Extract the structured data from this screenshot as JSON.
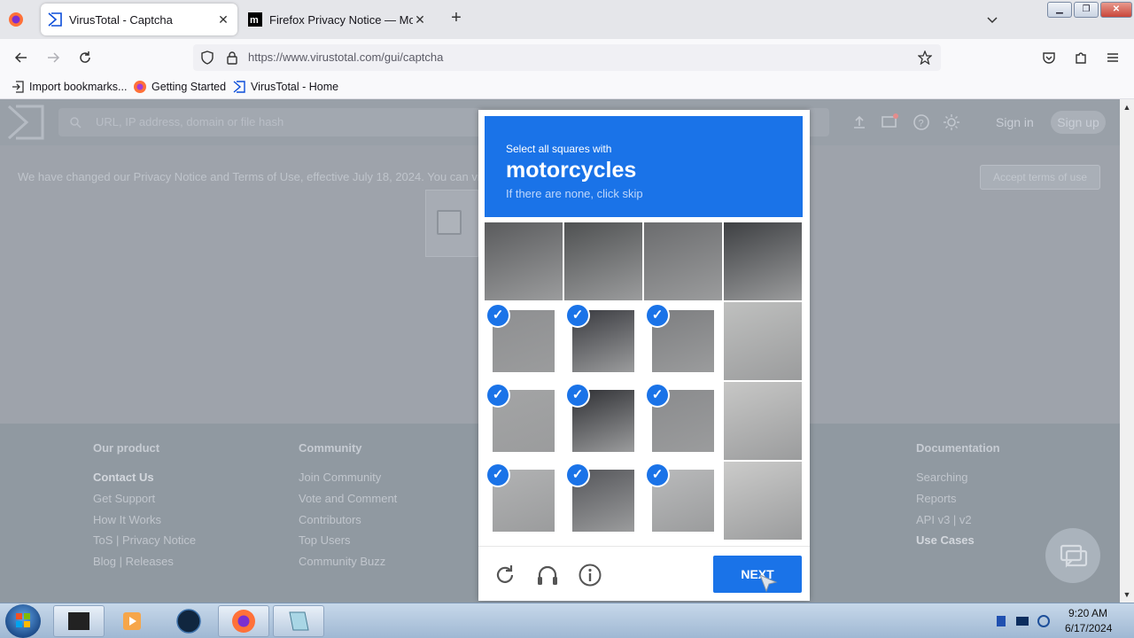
{
  "browser": {
    "tabs": [
      {
        "title": "VirusTotal - Captcha",
        "favicon": "virustotal-icon",
        "active": true
      },
      {
        "title": "Firefox Privacy Notice — Mozilla",
        "favicon": "mozilla-icon",
        "active": false
      }
    ],
    "url": "https://www.virustotal.com/gui/captcha",
    "bookmarks": [
      {
        "label": "Import bookmarks...",
        "icon": "import-icon"
      },
      {
        "label": "Getting Started",
        "icon": "firefox-icon"
      },
      {
        "label": "VirusTotal - Home",
        "icon": "virustotal-icon"
      }
    ]
  },
  "virustotal": {
    "search_placeholder": "URL, IP address, domain or file hash",
    "sign_in": "Sign in",
    "sign_up": "Sign up",
    "privacy_notice": "We have changed our Privacy Notice and Terms of Use, effective July 18, 2024. You can view",
    "accept_terms": "Accept terms of use",
    "footer": {
      "our_product": {
        "heading": "Our product",
        "links": [
          "Contact Us",
          "Get Support",
          "How It Works",
          "ToS | Privacy Notice",
          "Blog | Releases"
        ]
      },
      "community": {
        "heading": "Community",
        "links": [
          "Join Community",
          "Vote and Comment",
          "Contributors",
          "Top Users",
          "Community Buzz"
        ]
      },
      "documentation": {
        "heading": "Documentation",
        "links": [
          "Searching",
          "Reports",
          "API v3 | v2",
          "Use Cases"
        ]
      }
    }
  },
  "captcha": {
    "prompt": "Select all squares with",
    "object": "motorcycles",
    "hint": "If there are none, click skip",
    "grid_size": 4,
    "selected_tiles": [
      4,
      5,
      6,
      8,
      9,
      10,
      12,
      13,
      14
    ],
    "next_label": "NEXT",
    "accent_color": "#1a73e8"
  },
  "taskbar": {
    "time": "9:20 AM",
    "date": "6/17/2024"
  }
}
